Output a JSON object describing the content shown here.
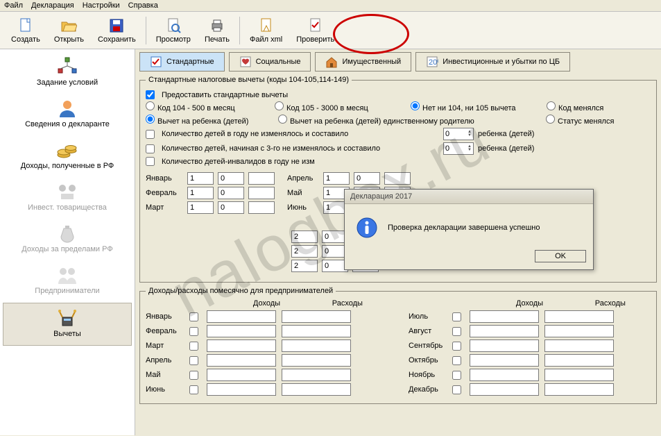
{
  "menu": {
    "file": "Файл",
    "decl": "Декларация",
    "settings": "Настройки",
    "help": "Справка"
  },
  "toolbar": {
    "create": "Создать",
    "open": "Открыть",
    "save": "Сохранить",
    "preview": "Просмотр",
    "print": "Печать",
    "xml": "Файл xml",
    "check": "Проверить"
  },
  "sidebar": {
    "cond": "Задание условий",
    "declarant": "Сведения о декларанте",
    "income_rf": "Доходы, полученные в РФ",
    "invest": "Инвест. товарищества",
    "income_abroad": "Доходы за пределами РФ",
    "entrep": "Предприниматели",
    "deduct": "Вычеты"
  },
  "tabs": {
    "standard": "Стандартные",
    "social": "Социальные",
    "property": "Имущественный",
    "invest_loss": "Инвестиционные и убытки по ЦБ"
  },
  "group1": {
    "legend": "Стандартные налоговые вычеты (коды 104-105,114-149)",
    "provide": "Предоставить стандартные вычеты",
    "r1": "Код 104 - 500 в месяц",
    "r2": "Код 105 - 3000 в месяц",
    "r3": "Нет ни 104, ни 105 вычета",
    "r4": "Код менялся",
    "r5": "Вычет на ребенка (детей)",
    "r6": "Вычет на ребенка (детей) единственному родителю",
    "r7": "Статус менялся",
    "c1": "Количество детей в году не изменялось и составило",
    "c2": "Количество детей, начиная с 3-го не изменялось и составило",
    "c3": "Количество детей-инвалидов в году не изм",
    "child_suffix": "ребенка (детей)"
  },
  "months1": {
    "jan": "Январь",
    "feb": "Февраль",
    "mar": "Март",
    "apr": "Апрель",
    "may": "Май",
    "jun": "Июнь",
    "v1": "1",
    "v0": "0",
    "v2": "2"
  },
  "group2": {
    "legend": "Доходы/расходы помесячно для предпринимателей",
    "income": "Доходы",
    "expense": "Расходы"
  },
  "months2": {
    "jan": "Январь",
    "feb": "Февраль",
    "mar": "Март",
    "apr": "Апрель",
    "may": "Май",
    "jun": "Июнь",
    "jul": "Июль",
    "aug": "Август",
    "sep": "Сентябрь",
    "oct": "Октябрь",
    "nov": "Ноябрь",
    "dec": "Декабрь"
  },
  "spin": {
    "v0": "0"
  },
  "dialog": {
    "title": "Декларация 2017",
    "msg": "Проверка декларации завершена успешно",
    "ok": "OK"
  },
  "watermark": "nalogbox.ru"
}
